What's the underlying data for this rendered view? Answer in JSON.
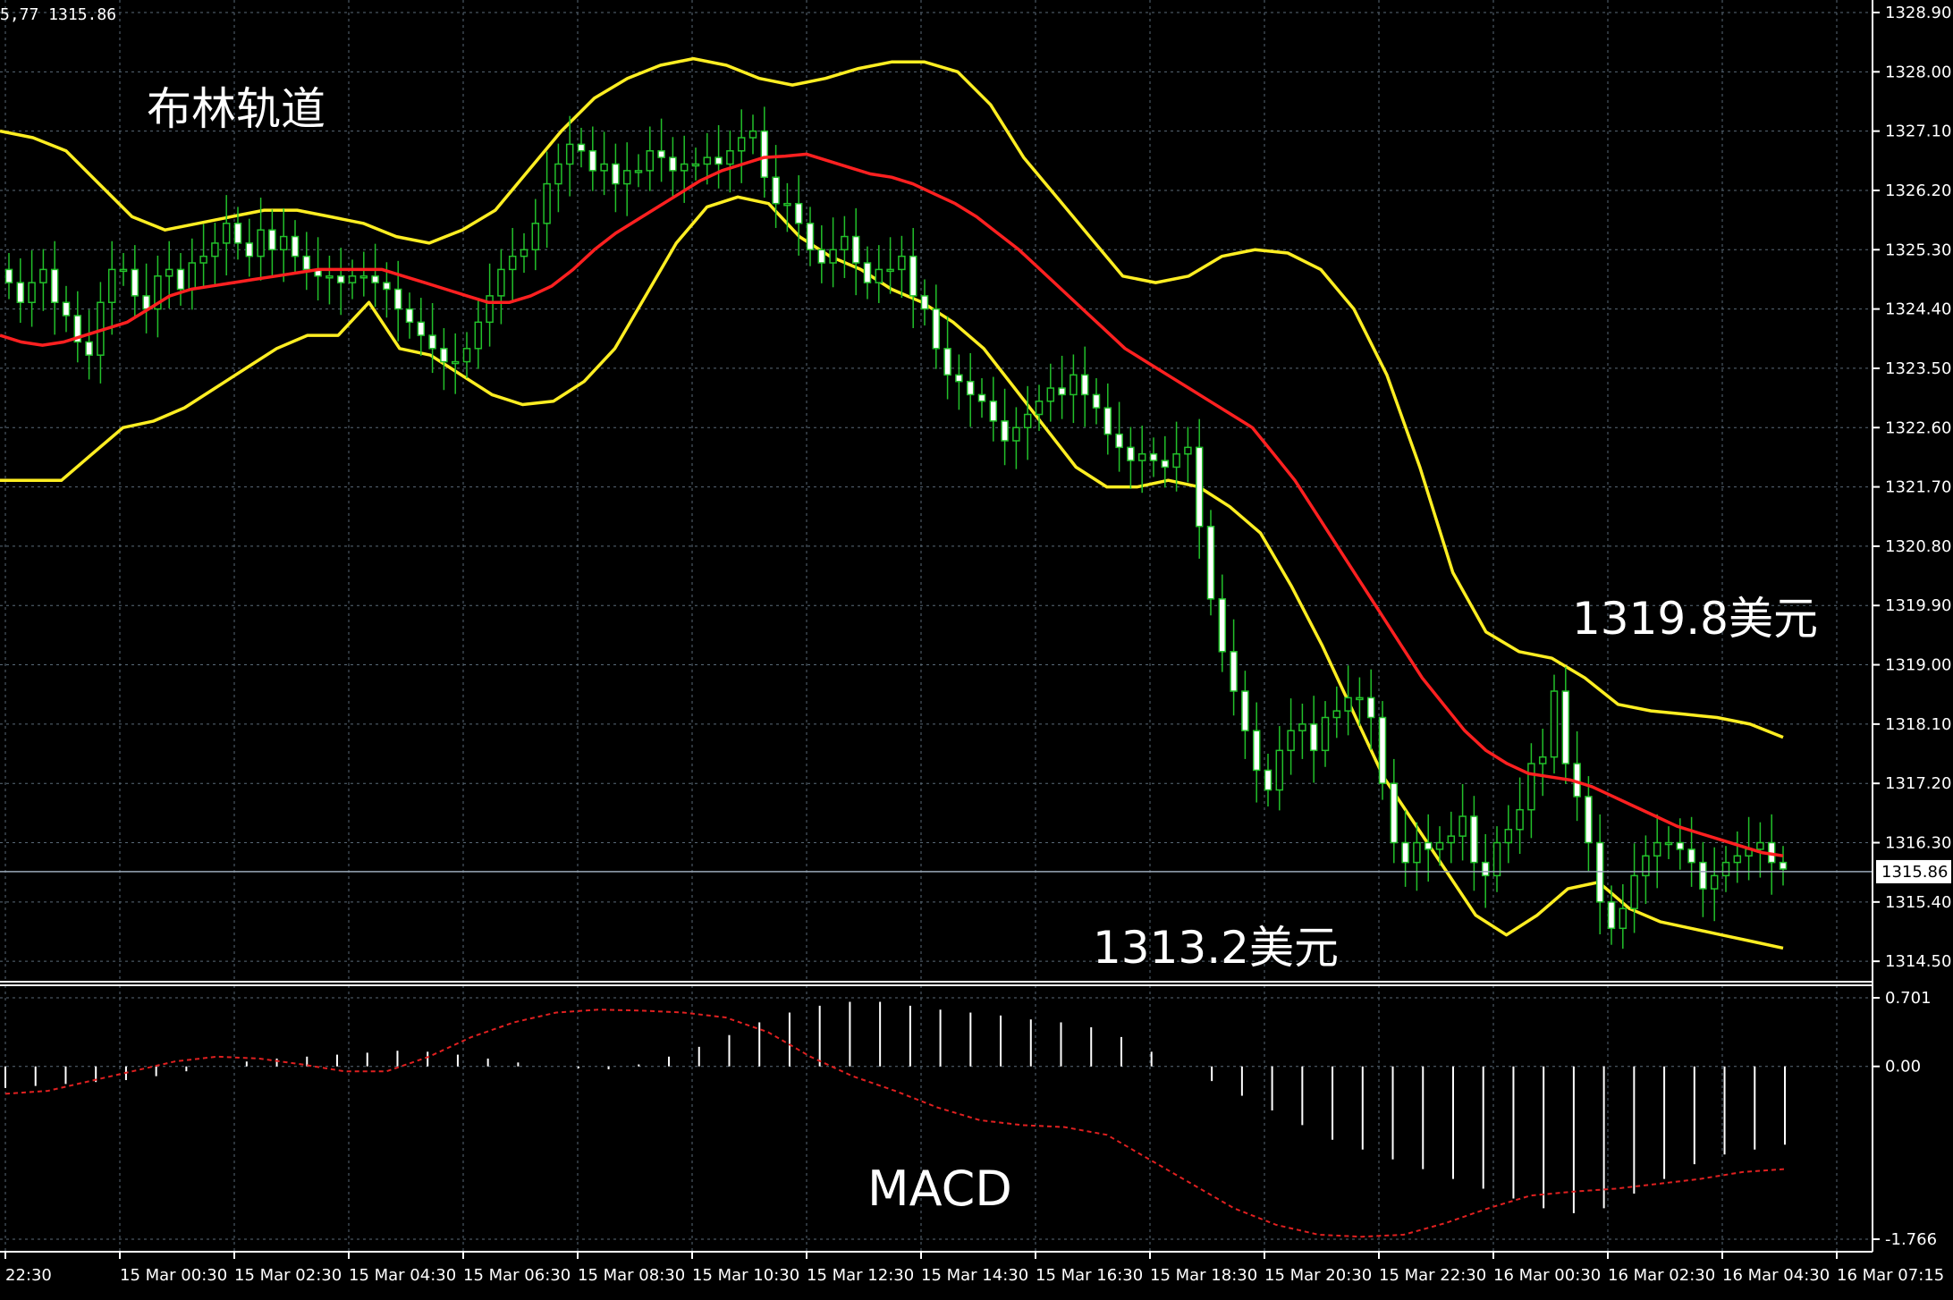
{
  "header": {
    "ticker": "5,77 1315.86"
  },
  "annotations": {
    "indicator_title": "布林轨道",
    "upper_level": "1319.8美元",
    "lower_level": "1313.2美元",
    "macd_label": "MACD"
  },
  "colors": {
    "background": "#000000",
    "grid": "#5a6a78",
    "bullish_candle": "#22c02a",
    "bearish_candle": "#ffffff",
    "bollinger_bands": "#ffee22",
    "middle_band": "#ff2020",
    "macd_histogram": "#ffffff",
    "macd_signal": "#e02020",
    "current_price_line": "#9aa8b8"
  },
  "chart_data": [
    {
      "type": "candlestick",
      "title": "布林轨道",
      "current_price": "1315.86",
      "ylim": [
        1314.0,
        1328.9
      ],
      "y_ticks": [
        "1328.90",
        "1328.00",
        "1327.10",
        "1326.20",
        "1325.30",
        "1324.40",
        "1323.50",
        "1322.60",
        "1321.70",
        "1320.80",
        "1319.90",
        "1319.00",
        "1318.10",
        "1317.20",
        "1316.30",
        "1315.40",
        "1314.50"
      ],
      "y_tick_values": [
        1328.9,
        1328.0,
        1327.1,
        1326.2,
        1325.3,
        1324.4,
        1323.5,
        1322.6,
        1321.7,
        1320.8,
        1319.9,
        1319.0,
        1318.1,
        1317.2,
        1316.3,
        1315.4,
        1314.5
      ],
      "x_ticks": [
        "22:30",
        "15 Mar 00:30",
        "15 Mar 02:30",
        "15 Mar 04:30",
        "15 Mar 06:30",
        "15 Mar 08:30",
        "15 Mar 10:30",
        "15 Mar 12:30",
        "15 Mar 14:30",
        "15 Mar 16:30",
        "15 Mar 18:30",
        "15 Mar 20:30",
        "15 Mar 22:30",
        "16 Mar 00:30",
        "16 Mar 02:30",
        "16 Mar 04:30",
        "16 Mar 07:15"
      ],
      "bar_count": 156,
      "close": [
        1324.8,
        1324.5,
        1324.8,
        1325.0,
        1324.5,
        1324.3,
        1323.9,
        1323.7,
        1324.5,
        1325.0,
        1325.0,
        1324.6,
        1324.4,
        1324.9,
        1325.0,
        1324.7,
        1325.1,
        1325.2,
        1325.4,
        1325.7,
        1325.4,
        1325.2,
        1325.6,
        1325.3,
        1325.5,
        1325.2,
        1325.0,
        1324.9,
        1324.9,
        1324.8,
        1324.9,
        1324.9,
        1324.8,
        1324.7,
        1324.4,
        1324.2,
        1324.0,
        1323.8,
        1323.6,
        1323.6,
        1323.8,
        1324.2,
        1324.6,
        1325.0,
        1325.2,
        1325.3,
        1325.7,
        1326.3,
        1326.6,
        1326.9,
        1326.8,
        1326.5,
        1326.6,
        1326.3,
        1326.5,
        1326.5,
        1326.8,
        1326.7,
        1326.5,
        1326.6,
        1326.6,
        1326.7,
        1326.6,
        1326.8,
        1327.0,
        1327.1,
        1326.4,
        1326.0,
        1326.0,
        1325.7,
        1325.3,
        1325.1,
        1325.3,
        1325.5,
        1325.1,
        1324.8,
        1325.0,
        1325.0,
        1325.2,
        1324.6,
        1324.4,
        1323.8,
        1323.4,
        1323.3,
        1323.1,
        1323.0,
        1322.7,
        1322.4,
        1322.6,
        1322.8,
        1323.0,
        1323.2,
        1323.1,
        1323.4,
        1323.1,
        1322.9,
        1322.5,
        1322.3,
        1322.1,
        1322.2,
        1322.1,
        1322.0,
        1322.2,
        1322.3,
        1321.1,
        1320.0,
        1319.2,
        1318.6,
        1318.0,
        1317.4,
        1317.1,
        1317.7,
        1318.0,
        1318.1,
        1317.7,
        1318.2,
        1318.3,
        1318.5,
        1318.5,
        1318.2,
        1317.2,
        1316.3,
        1316.0,
        1316.3,
        1316.2,
        1316.3,
        1316.4,
        1316.7,
        1316.0,
        1315.8,
        1316.3,
        1316.5,
        1316.8,
        1317.5,
        1317.6,
        1318.6,
        1317.5,
        1317.0,
        1316.3,
        1315.4,
        1315.0,
        1315.3,
        1315.8,
        1316.1,
        1316.3,
        1316.3,
        1316.2,
        1316.0,
        1315.6,
        1315.8,
        1316.0,
        1316.1,
        1316.2,
        1316.3,
        1316.0,
        1315.9
      ],
      "middle_band": [
        1324.0,
        1323.9,
        1323.85,
        1323.9,
        1324.0,
        1324.1,
        1324.2,
        1324.4,
        1324.6,
        1324.7,
        1324.75,
        1324.8,
        1324.85,
        1324.9,
        1324.95,
        1325.0,
        1325.0,
        1325.0,
        1325.0,
        1324.9,
        1324.8,
        1324.7,
        1324.6,
        1324.5,
        1324.5,
        1324.6,
        1324.75,
        1325.0,
        1325.3,
        1325.55,
        1325.75,
        1325.95,
        1326.15,
        1326.35,
        1326.5,
        1326.6,
        1326.7,
        1326.72,
        1326.75,
        1326.65,
        1326.55,
        1326.45,
        1326.4,
        1326.3,
        1326.15,
        1326.0,
        1325.8,
        1325.55,
        1325.3,
        1325.0,
        1324.7,
        1324.4,
        1324.1,
        1323.8,
        1323.6,
        1323.4,
        1323.2,
        1323.0,
        1322.8,
        1322.6,
        1322.2,
        1321.8,
        1321.3,
        1320.8,
        1320.3,
        1319.8,
        1319.3,
        1318.8,
        1318.4,
        1318.0,
        1317.7,
        1317.5,
        1317.35,
        1317.3,
        1317.25,
        1317.15,
        1317.0,
        1316.85,
        1316.7,
        1316.55,
        1316.45,
        1316.35,
        1316.25,
        1316.15,
        1316.1
      ],
      "upper_band": [
        1327.1,
        1327.0,
        1326.8,
        1326.3,
        1325.8,
        1325.6,
        1325.7,
        1325.8,
        1325.9,
        1325.9,
        1325.8,
        1325.7,
        1325.5,
        1325.4,
        1325.6,
        1325.9,
        1326.5,
        1327.1,
        1327.6,
        1327.9,
        1328.1,
        1328.2,
        1328.1,
        1327.9,
        1327.8,
        1327.9,
        1328.05,
        1328.15,
        1328.15,
        1328.0,
        1327.5,
        1326.7,
        1326.1,
        1325.5,
        1324.9,
        1324.8,
        1324.9,
        1325.2,
        1325.3,
        1325.25,
        1325.0,
        1324.4,
        1323.4,
        1322.0,
        1320.4,
        1319.5,
        1319.2,
        1319.1,
        1318.8,
        1318.4,
        1318.3,
        1318.25,
        1318.2,
        1318.1,
        1317.9
      ],
      "lower_band": [
        1321.8,
        1321.8,
        1321.8,
        1322.2,
        1322.6,
        1322.7,
        1322.9,
        1323.2,
        1323.5,
        1323.8,
        1324.0,
        1324.0,
        1324.5,
        1323.8,
        1323.7,
        1323.4,
        1323.1,
        1322.95,
        1323.0,
        1323.3,
        1323.8,
        1324.6,
        1325.4,
        1325.95,
        1326.1,
        1326.0,
        1325.5,
        1325.2,
        1325.0,
        1324.7,
        1324.5,
        1324.2,
        1323.8,
        1323.2,
        1322.6,
        1322.0,
        1321.7,
        1321.7,
        1321.8,
        1321.7,
        1321.4,
        1321.0,
        1320.2,
        1319.3,
        1318.3,
        1317.3,
        1316.6,
        1315.9,
        1315.2,
        1314.9,
        1315.2,
        1315.6,
        1315.7,
        1315.3,
        1315.1,
        1315.0,
        1314.9,
        1314.8,
        1314.7
      ]
    },
    {
      "type": "bar",
      "title": "MACD",
      "ylim": [
        -1.766,
        0.701
      ],
      "y_ticks": [
        "0.701",
        "0.00",
        "-1.766"
      ],
      "y_tick_values": [
        0.701,
        0.0,
        -1.766
      ],
      "histogram": [
        -0.22,
        -0.2,
        -0.18,
        -0.16,
        -0.14,
        -0.1,
        -0.05,
        0.0,
        0.05,
        0.08,
        0.1,
        0.12,
        0.14,
        0.16,
        0.15,
        0.12,
        0.08,
        0.04,
        0.0,
        -0.02,
        -0.03,
        0.02,
        0.1,
        0.2,
        0.32,
        0.45,
        0.55,
        0.62,
        0.66,
        0.66,
        0.62,
        0.58,
        0.55,
        0.52,
        0.48,
        0.45,
        0.4,
        0.3,
        0.15,
        0.0,
        -0.15,
        -0.3,
        -0.45,
        -0.6,
        -0.75,
        -0.85,
        -0.95,
        -1.05,
        -1.15,
        -1.25,
        -1.35,
        -1.45,
        -1.5,
        -1.45,
        -1.3,
        -1.15,
        -1.0,
        -0.9,
        -0.85,
        -0.8
      ],
      "signal": [
        -0.28,
        -0.25,
        -0.15,
        -0.05,
        0.05,
        0.1,
        0.08,
        0.02,
        -0.05,
        -0.05,
        0.1,
        0.3,
        0.45,
        0.55,
        0.58,
        0.57,
        0.55,
        0.5,
        0.35,
        0.1,
        -0.1,
        -0.25,
        -0.42,
        -0.55,
        -0.6,
        -0.62,
        -0.7,
        -0.95,
        -1.2,
        -1.45,
        -1.62,
        -1.72,
        -1.74,
        -1.72,
        -1.6,
        -1.45,
        -1.32,
        -1.28,
        -1.25,
        -1.2,
        -1.15,
        -1.08,
        -1.05
      ]
    }
  ]
}
